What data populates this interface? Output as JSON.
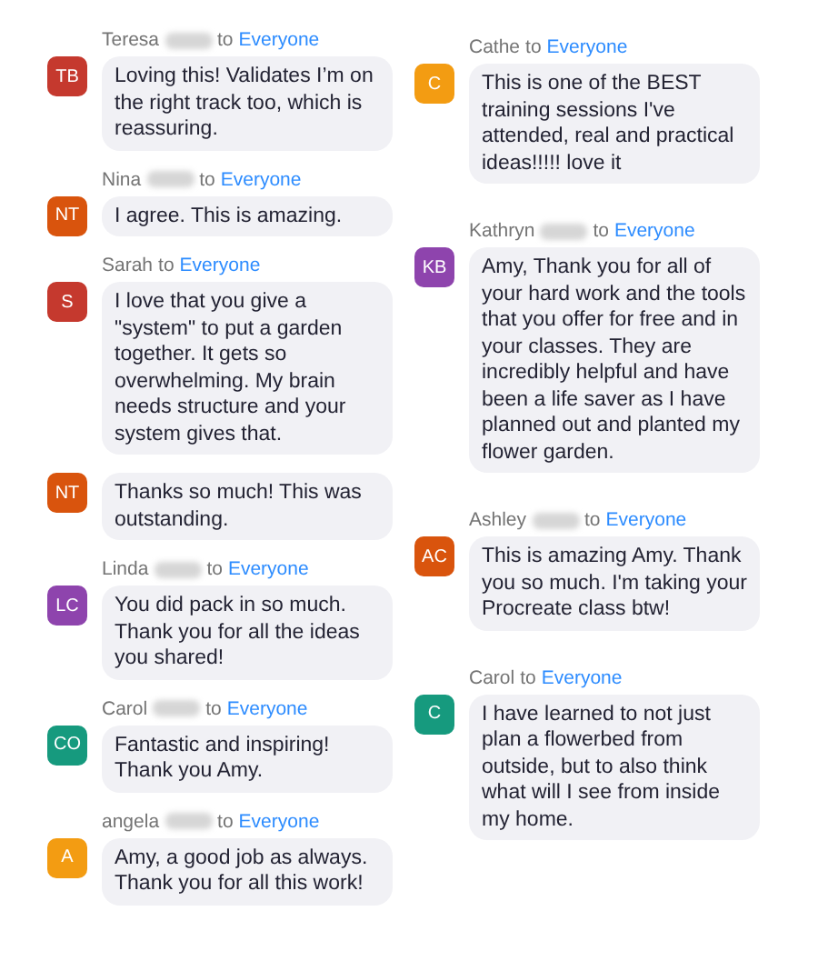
{
  "columns": [
    {
      "messages": [
        {
          "initials": "TB",
          "color": "#c5392e",
          "first_name": "Teresa",
          "redacted": true,
          "to": "to",
          "recipient": "Everyone",
          "text": "Loving this! Validates I’m on the right track too, which is reassuring."
        },
        {
          "initials": "NT",
          "color": "#d9540d",
          "first_name": "Nina",
          "redacted": true,
          "to": "to",
          "recipient": "Everyone",
          "text": "I agree. This is amazing."
        },
        {
          "initials": "S",
          "color": "#c5392e",
          "first_name": "Sarah",
          "redacted": false,
          "to": "to",
          "recipient": "Everyone",
          "text": "I love that you give a \"system\" to put a garden together. It gets so overwhelming.  My brain needs structure and your system gives that."
        },
        {
          "initials": "NT",
          "color": "#d9540d",
          "text": "Thanks so much! This was outstanding."
        },
        {
          "initials": "LC",
          "color": "#8e44ad",
          "first_name": "Linda",
          "redacted": true,
          "to": "to",
          "recipient": "Everyone",
          "text": "You did pack in so much. Thank you for all the ideas you shared!"
        },
        {
          "initials": "CO",
          "color": "#169a7e",
          "first_name": "Carol",
          "redacted": true,
          "to": "to",
          "recipient": "Everyone",
          "text": "Fantastic and inspiring! Thank you Amy."
        },
        {
          "initials": "A",
          "color": "#f39c12",
          "first_name": "angela",
          "redacted": true,
          "to": "to",
          "recipient": "Everyone",
          "text": "Amy, a good job as always. Thank you for all this work!"
        }
      ]
    },
    {
      "messages": [
        {
          "initials": "C",
          "color": "#f39c12",
          "first_name": "Cathe",
          "redacted": false,
          "to": "to",
          "recipient": "Everyone",
          "text": "This is one of the BEST training sessions I've attended, real and practical ideas!!!!! love it"
        },
        {
          "initials": "KB",
          "color": "#8e44ad",
          "first_name": "Kathryn",
          "redacted": true,
          "to": "to",
          "recipient": "Everyone",
          "text": "Amy, Thank you for all of your hard work and the tools that you offer for free and in your classes.  They are incredibly helpful and have been a life saver as I have planned out and planted my flower garden."
        },
        {
          "initials": "AC",
          "color": "#d9540d",
          "first_name": "Ashley",
          "redacted": true,
          "to": "to",
          "recipient": "Everyone",
          "text": "This is amazing Amy. Thank you so much. I'm taking your Procreate class btw!"
        },
        {
          "initials": "C",
          "color": "#169a7e",
          "first_name": "Carol",
          "redacted": false,
          "to": "to",
          "recipient": "Everyone",
          "text": "I have learned to not just plan a flowerbed from outside, but to also think what will I see from inside my home."
        }
      ]
    }
  ]
}
